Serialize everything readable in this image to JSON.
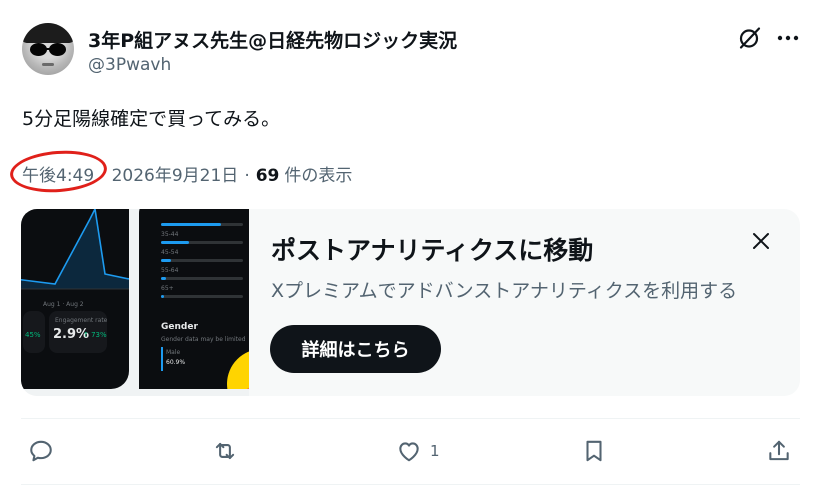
{
  "author": {
    "display_name": "3年P組アヌス先生@日経先物ロジック実況",
    "handle": "@3Pwavh"
  },
  "tweet": {
    "text": "5分足陽線確定で買ってみる。",
    "time": "午後4:49",
    "separator": "·",
    "date": "2026年9月21日",
    "views_count": "69",
    "views_label": "件の表示"
  },
  "card": {
    "title": "ポストアナリティクスに移動",
    "subtitle": "Xプレミアムでアドバンストアナリティクスを利用する",
    "button_label": "詳細はこちら",
    "preview": {
      "stat_value": "2.9%",
      "stat_delta": "↑ 73%",
      "left_delta": "45%",
      "gender_label": "Gender",
      "male_label": "Male",
      "male_value": "60.9%"
    }
  },
  "actions": {
    "replies": "",
    "reposts": "",
    "likes": "1",
    "bookmarks": ""
  },
  "icons": {
    "grok": "grok-icon",
    "more": "more-horizontal-icon",
    "close": "close-icon",
    "reply": "reply-icon",
    "repost": "repost-icon",
    "like": "heart-icon",
    "bookmark": "bookmark-icon",
    "share": "share-icon"
  },
  "colors": {
    "text": "#0f1419",
    "secondary": "#536471",
    "accent": "#1d9bf0",
    "annotation": "#e0201a",
    "card_bg": "#f7f9f9"
  }
}
